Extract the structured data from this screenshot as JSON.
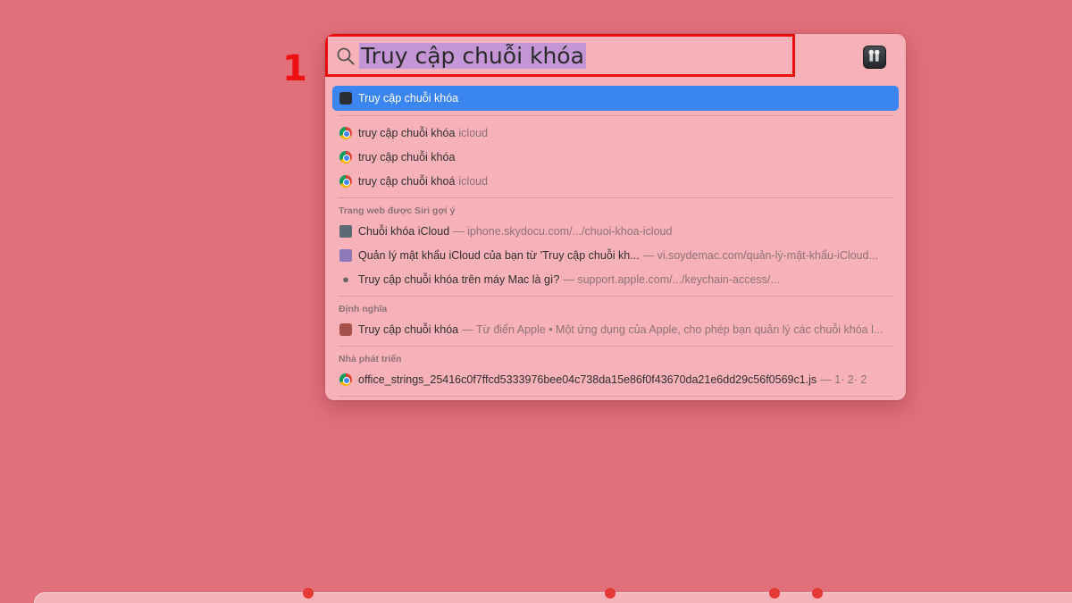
{
  "annotation": {
    "step": "1"
  },
  "search": {
    "query": "Truy cập chuỗi khóa"
  },
  "top_hit": {
    "label": "Truy cập chuỗi khóa"
  },
  "suggestions": [
    {
      "text": "truy cập chuỗi khóa",
      "suffix": "icloud"
    },
    {
      "text": "truy cập chuỗi khóa",
      "suffix": ""
    },
    {
      "text": "truy cập chuỗi khoá",
      "suffix": "icloud"
    }
  ],
  "siri_section": {
    "title": "Trang web được Siri gợi ý",
    "items": [
      {
        "title": "Chuỗi khóa iCloud",
        "url": "— iphone.skydocu.com/.../chuoi-khoa-icloud"
      },
      {
        "title": "Quản lý mật khẩu iCloud của bạn từ 'Truy cập chuỗi kh...",
        "url": "— vi.soydemac.com/quản-lý-mật-khẩu-iCloud..."
      },
      {
        "title": "Truy cập chuỗi khóa trên máy Mac là gì?",
        "url": "— support.apple.com/.../keychain-access/..."
      }
    ]
  },
  "definition_section": {
    "title": "Định nghĩa",
    "item": {
      "title": "Truy cập chuỗi khóa",
      "detail": "— Từ điển Apple • Một ứng dụng của Apple, cho phép bạn quản lý các chuỗi khóa l..."
    }
  },
  "developer_section": {
    "title": "Nhà phát triển",
    "item": {
      "title": "office_strings_25416c0f7ffcd5333976bee04c738da15e86f0f43670da21e6dd29c56f0569c1.js",
      "detail": "— 1· 2· 2"
    }
  },
  "colors": {
    "background": "#e2707b",
    "panel": "#f7b1b9",
    "selection": "#3a86ee",
    "annotation": "#ea0d0d"
  }
}
